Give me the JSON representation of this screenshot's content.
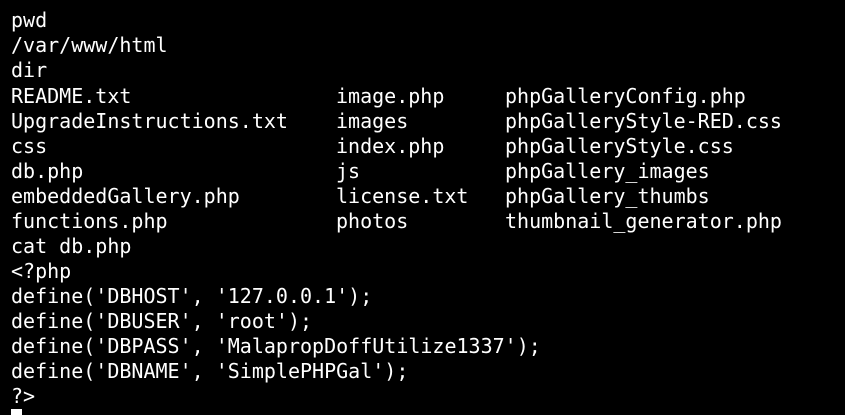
{
  "terminal": {
    "lines": [
      "pwd",
      "/var/www/html",
      "dir"
    ],
    "listing": [
      [
        "README.txt",
        "image.php",
        "phpGalleryConfig.php"
      ],
      [
        "UpgradeInstructions.txt",
        "images",
        "phpGalleryStyle-RED.css"
      ],
      [
        "css",
        "index.php",
        "phpGalleryStyle.css"
      ],
      [
        "db.php",
        "js",
        "phpGallery_images"
      ],
      [
        "embeddedGallery.php",
        "license.txt",
        "phpGallery_thumbs"
      ],
      [
        "functions.php",
        "photos",
        "thumbnail_generator.php"
      ]
    ],
    "after": [
      "cat db.php",
      "<?php",
      "define('DBHOST', '127.0.0.1');",
      "define('DBUSER', 'root');",
      "define('DBPASS', 'MalapropDoffUtilize1337');",
      "define('DBNAME', 'SimplePHPGal');",
      "?>"
    ]
  }
}
